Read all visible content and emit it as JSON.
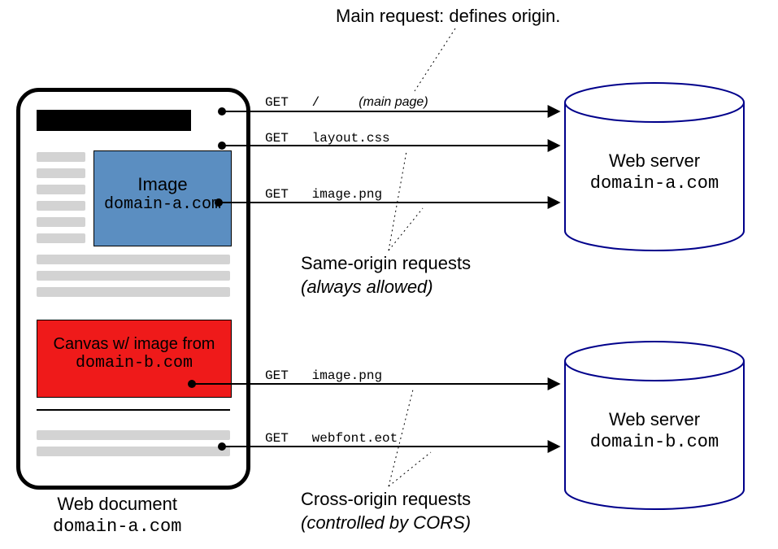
{
  "header_note": "Main request: defines origin.",
  "document": {
    "caption_title": "Web document",
    "caption_domain": "domain-a.com",
    "image_label": "Image",
    "image_domain": "domain-a.com",
    "canvas_label": "Canvas w/ image from",
    "canvas_domain": "domain-b.com"
  },
  "servers": {
    "a": {
      "title": "Web server",
      "domain": "domain-a.com"
    },
    "b": {
      "title": "Web server",
      "domain": "domain-b.com"
    }
  },
  "requests": {
    "main": {
      "method": "GET",
      "path": "/",
      "note": "(main page)"
    },
    "css": {
      "method": "GET",
      "path": "layout.css"
    },
    "imgA": {
      "method": "GET",
      "path": "image.png"
    },
    "imgB": {
      "method": "GET",
      "path": "image.png"
    },
    "font": {
      "method": "GET",
      "path": "webfont.eot"
    }
  },
  "groups": {
    "same": {
      "title": "Same-origin requests",
      "sub": "(always allowed)"
    },
    "cross": {
      "title": "Cross-origin requests",
      "sub": "(controlled by CORS)"
    }
  },
  "colors": {
    "blue_box": "#5b8ec1",
    "red_box": "#ef1a1a",
    "server_stroke": "#00008b"
  }
}
